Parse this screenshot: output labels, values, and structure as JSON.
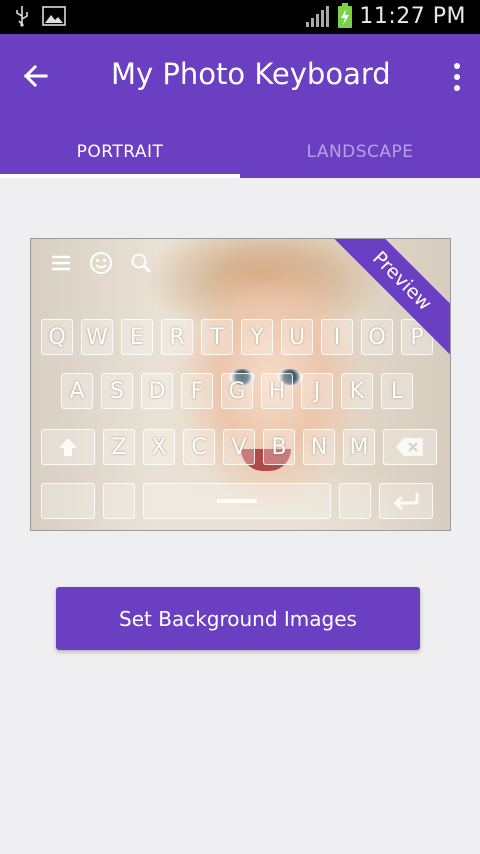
{
  "status_bar": {
    "time": "11:27 PM",
    "icons": [
      "usb-icon",
      "image-notification-icon",
      "signal-icon",
      "battery-charging-icon"
    ]
  },
  "app_bar": {
    "title": "My Photo Keyboard",
    "back_icon": "arrow-left-icon",
    "menu_icon": "more-vert-icon"
  },
  "tabs": [
    {
      "label": "PORTRAIT",
      "active": true
    },
    {
      "label": "LANDSCAPE",
      "active": false
    }
  ],
  "preview": {
    "ribbon_label": "Preview",
    "toolbar_icons": [
      "menu-icon",
      "emoji-icon",
      "search-icon"
    ],
    "rows": [
      [
        "Q",
        "W",
        "E",
        "R",
        "T",
        "Y",
        "U",
        "I",
        "O",
        "P"
      ],
      [
        "A",
        "S",
        "D",
        "F",
        "G",
        "H",
        "J",
        "K",
        "L"
      ],
      [
        "Z",
        "X",
        "C",
        "V",
        "B",
        "N",
        "M"
      ]
    ]
  },
  "action_button": {
    "label": "Set Background Images"
  },
  "colors": {
    "primary": "#6a3fc1",
    "tab_inactive": "#b6a2e6",
    "background": "#efeff1"
  }
}
